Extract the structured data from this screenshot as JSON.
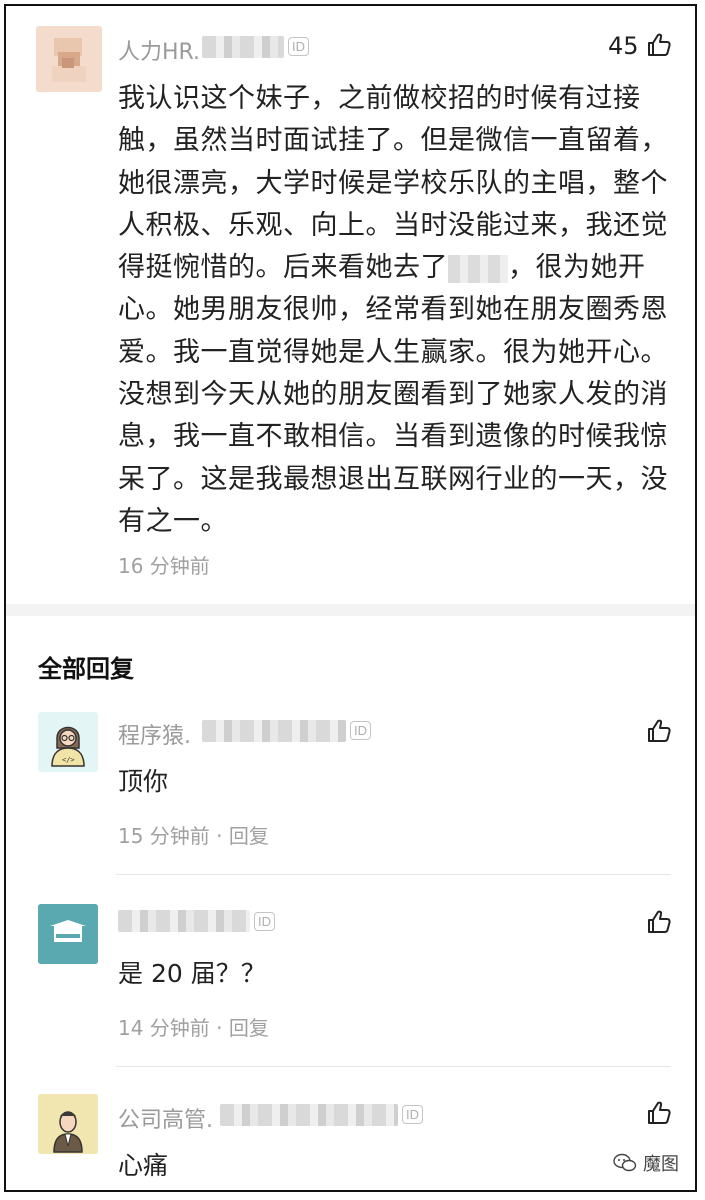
{
  "comment": {
    "username": "人力HR.",
    "id_badge": "ID",
    "like_count": "45",
    "text_part1": "我认识这个妹子，之前做校招的时候有过接触，虽然当时面试挂了。但是微信一直留着，她很漂亮，大学时候是学校乐队的主唱，整个人积极、乐观、向上。当时没能过来，我还觉得挺惋惜的。后来看她去了",
    "text_part2": "，很为她开心。她男朋友很帅，经常看到她在朋友圈秀恩爱。我一直觉得她是人生赢家。很为她开心。 没想到今天从她的朋友圈看到了她家人发的消息，我一直不敢相信。当看到遗像的时候我惊呆了。这是我最想退出互联网行业的一天，没有之一。",
    "time": "16 分钟前"
  },
  "replies_section": {
    "title": "全部回复"
  },
  "replies": [
    {
      "username": "程序猿.",
      "id_badge": "ID",
      "text": "顶你",
      "time": "15 分钟前",
      "reply_label": "回复",
      "dot": "·"
    },
    {
      "username": "",
      "id_badge": "ID",
      "text": "是 20 届？？",
      "time": "14 分钟前",
      "reply_label": "回复",
      "dot": "·"
    },
    {
      "username": "公司高管.",
      "id_badge": "ID",
      "text": "心痛"
    }
  ],
  "watermark": {
    "text": "魔图"
  },
  "colors": {
    "meta_gray": "#a0a0a0",
    "avatar_teal": "#5aa9b0",
    "avatar_yellow": "#f2e6b0"
  }
}
